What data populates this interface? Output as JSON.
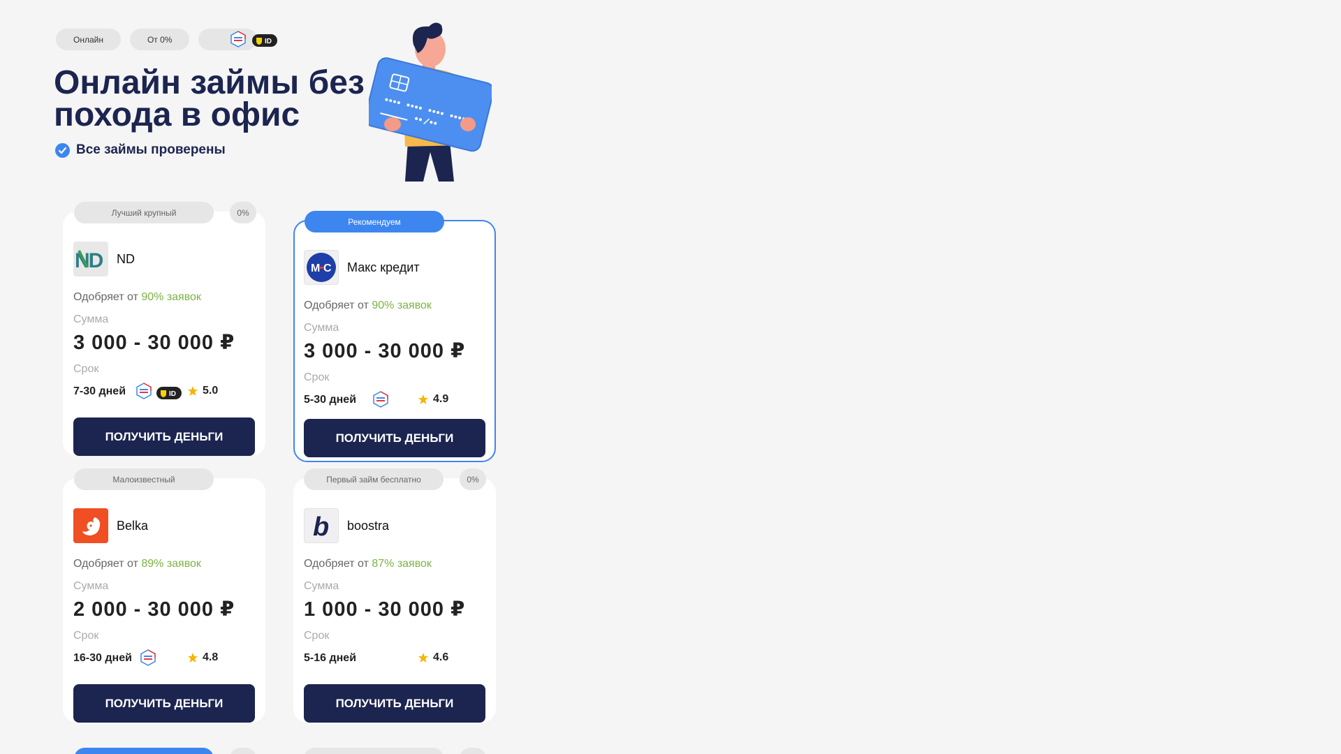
{
  "hero": {
    "chips": [
      "Онлайн",
      "От 0%"
    ],
    "title": "Онлайн займы без похода в офис",
    "checked_note": "Все займы проверены"
  },
  "badges": {
    "id_label": "ID",
    "gos_label": "гос услуги"
  },
  "cards": [
    {
      "tag": "Лучший крупный",
      "percent": "0%",
      "name": "ND",
      "logo": "nd-logo",
      "approve_prefix": "Одобряет от",
      "approve_rate": "90% заявок",
      "sum_label": "Сумма",
      "amount": "3 000 - 30 000 ₽",
      "term_label": "Срок",
      "term": "7-30 дней",
      "rating": "5.0",
      "button": "ПОЛУЧИТЬ ДЕНЬГИ"
    },
    {
      "tag": "Рекомендуем",
      "percent": "",
      "name": "Макс кредит",
      "logo": "mc-logo",
      "approve_prefix": "Одобряет от",
      "approve_rate": "90% заявок",
      "sum_label": "Сумма",
      "amount": "3 000 - 30 000 ₽",
      "term_label": "Срок",
      "term": "5-30 дней",
      "rating": "4.9",
      "button": "ПОЛУЧИТЬ ДЕНЬГИ"
    },
    {
      "tag": "Малоизвестный",
      "percent": "",
      "name": "Belka",
      "logo": "belka-logo",
      "approve_prefix": "Одобряет от",
      "approve_rate": "89% заявок",
      "sum_label": "Сумма",
      "amount": "2 000 - 30 000 ₽",
      "term_label": "Срок",
      "term": "16-30 дней",
      "rating": "4.8",
      "button": "ПОЛУЧИТЬ ДЕНЬГИ"
    },
    {
      "tag": "Первый займ бесплатно",
      "percent": "0%",
      "name": "boostra",
      "logo": "boostra-logo",
      "approve_prefix": "Одобряет от",
      "approve_rate": "87% заявок",
      "sum_label": "Сумма",
      "amount": "1 000 - 30 000 ₽",
      "term_label": "Срок",
      "term": "5-16 дней",
      "rating": "4.6",
      "button": "ПОЛУЧИТЬ ДЕНЬГИ"
    }
  ],
  "colors": {
    "navy": "#1c2550",
    "blue": "#3d86f0",
    "green": "#7bb341",
    "star": "#f5b50a",
    "belka": "#f04e23",
    "mc": "#1f3fa8"
  }
}
